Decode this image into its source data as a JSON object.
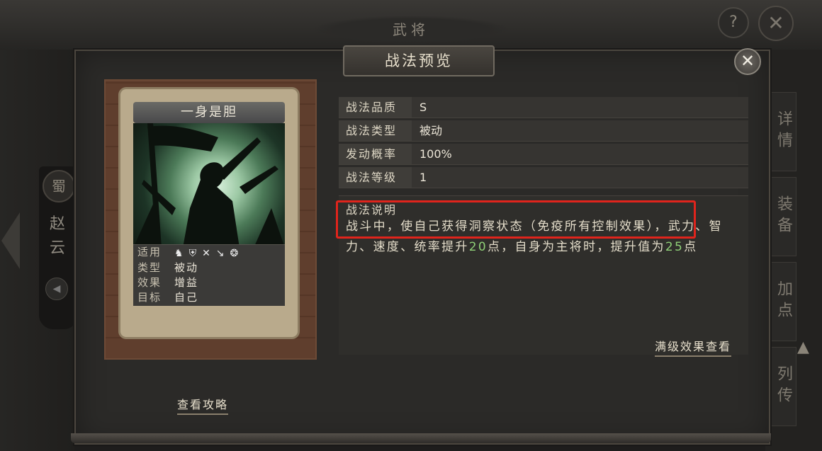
{
  "background": {
    "window_title": "武将",
    "help_label": "?",
    "close_label": "✕",
    "faction_badge": "蜀",
    "general_name": "赵云",
    "side_tabs": [
      "详情",
      "装备",
      "加点",
      "列传"
    ]
  },
  "dialog": {
    "title": "战法预览",
    "close_label": "✕"
  },
  "card": {
    "name": "一身是胆",
    "stats": [
      {
        "key": "适用",
        "value": ""
      },
      {
        "key": "类型",
        "value": "被动"
      },
      {
        "key": "效果",
        "value": "增益"
      },
      {
        "key": "目标",
        "value": "自己"
      }
    ],
    "troop_icons": [
      "cavalry-icon",
      "shield-icon",
      "bow-icon",
      "spear-icon",
      "siege-icon"
    ]
  },
  "info": {
    "rows": [
      {
        "key": "战法品质",
        "value": "S"
      },
      {
        "key": "战法类型",
        "value": "被动"
      },
      {
        "key": "发动概率",
        "value": "100%"
      },
      {
        "key": "战法等级",
        "value": "1"
      }
    ],
    "description_label": "战法说明",
    "description_part1": "战斗中，使自己获得洞察状态（免疫所有控制效果），武力、智力、速度、统率提升",
    "description_value1": "20",
    "description_part2": "点，自身为主将时，提升值为",
    "description_value2": "25",
    "description_part3": "点",
    "full_effect_link": "满级效果查看"
  },
  "guide_link": "查看攻略",
  "colors": {
    "highlight": "#e0241c",
    "value_green": "#8fd077"
  }
}
